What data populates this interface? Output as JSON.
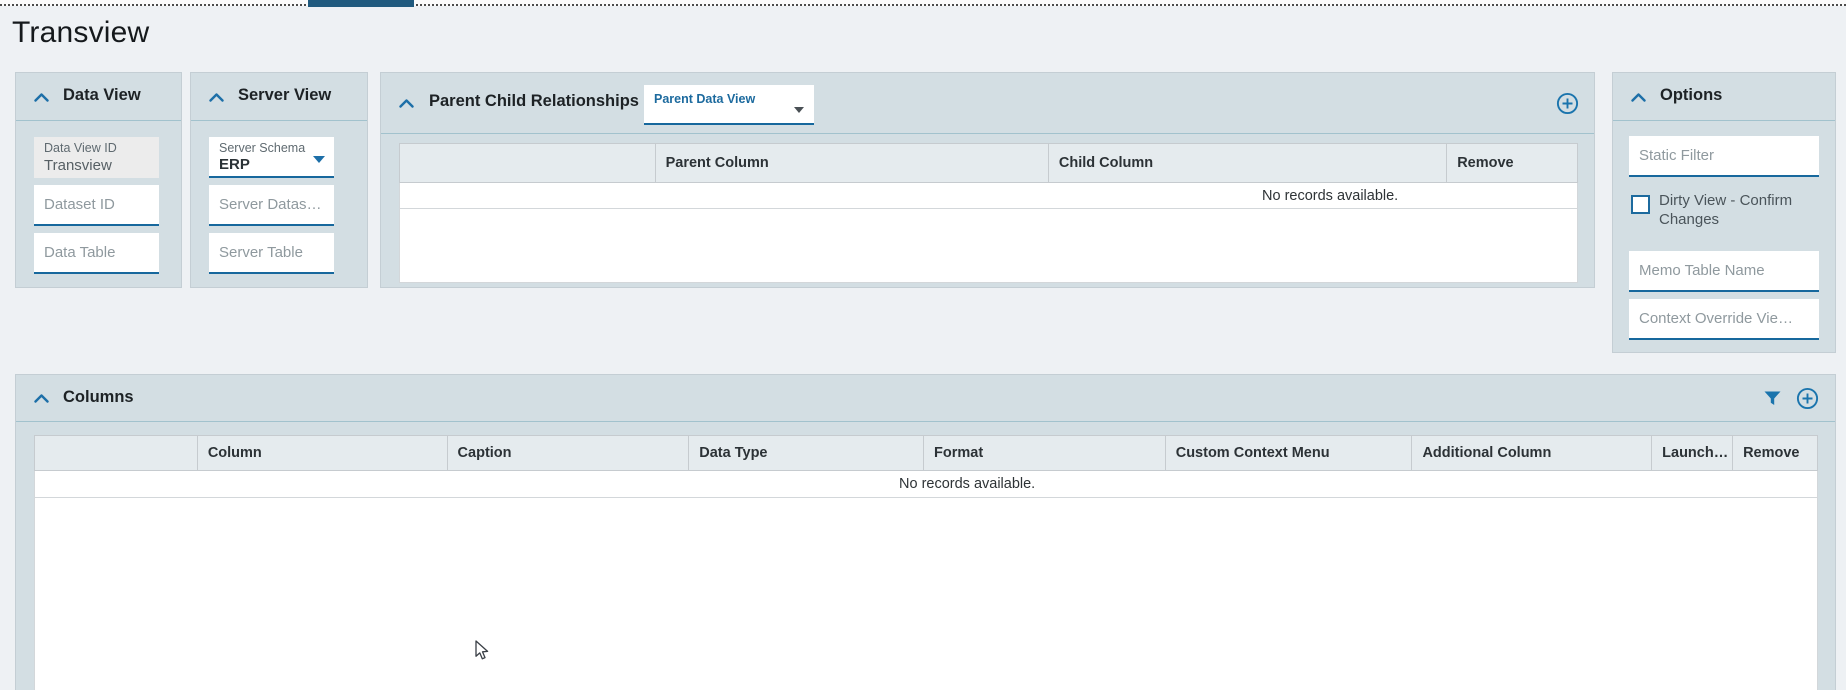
{
  "page": {
    "title": "Transview"
  },
  "panels": {
    "data_view": {
      "title": "Data View",
      "fields": {
        "data_view_id": {
          "label": "Data View ID",
          "value": "Transview"
        },
        "dataset_id": {
          "placeholder": "Dataset ID"
        },
        "data_table": {
          "placeholder": "Data Table"
        }
      }
    },
    "server_view": {
      "title": "Server View",
      "fields": {
        "server_schema": {
          "label": "Server Schema",
          "value": "ERP"
        },
        "server_dataset": {
          "placeholder": "Server Datas…"
        },
        "server_table": {
          "placeholder": "Server Table"
        }
      }
    },
    "parent_child": {
      "title": "Parent Child Relationships",
      "parent_data_view_label": "Parent Data View",
      "table": {
        "headers": [
          "",
          "Parent Column",
          "Child Column",
          "Remove"
        ],
        "empty_message": "No records available."
      }
    },
    "options": {
      "title": "Options",
      "static_filter": {
        "placeholder": "Static Filter"
      },
      "dirty_view": {
        "label": "Dirty View - Confirm Changes",
        "checked": false
      },
      "memo_table": {
        "placeholder": "Memo Table Name"
      },
      "context_override": {
        "placeholder": "Context Override Vie…"
      }
    },
    "columns": {
      "title": "Columns",
      "table": {
        "headers": [
          "",
          "Column",
          "Caption",
          "Data Type",
          "Format",
          "Custom Context Menu",
          "Additional Column",
          "Launch…",
          "Remove"
        ],
        "empty_message": "No records available."
      }
    }
  },
  "icons": {
    "collapse": "chevron-up",
    "add": "plus-circle",
    "filter": "funnel",
    "dropdown": "caret-down",
    "pointer": "arrow-cursor"
  },
  "colors": {
    "accent_blue": "#1a74ad",
    "field_underline": "#17689d",
    "panel_bg": "#d3dee3",
    "table_header_bg": "#e5ebee",
    "page_bg": "#eef1f4",
    "top_tab_indicator": "#205a7e"
  }
}
